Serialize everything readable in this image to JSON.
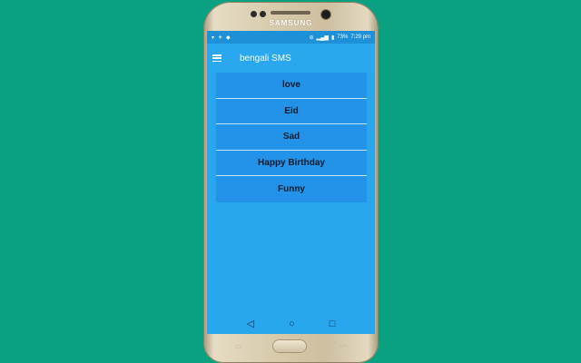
{
  "device": {
    "brand": "SAMSUNG"
  },
  "status_bar": {
    "battery": "73%",
    "time": "7:29 pm"
  },
  "app_bar": {
    "title": "bengali SMS"
  },
  "categories": [
    {
      "label": "love"
    },
    {
      "label": "Eid"
    },
    {
      "label": "Sad"
    },
    {
      "label": "Happy Birthday"
    },
    {
      "label": "Funny"
    }
  ],
  "colors": {
    "background": "#0aa183",
    "screen": "#28a6ee",
    "list": "#2293e8",
    "status_bar": "#1e90d8"
  }
}
